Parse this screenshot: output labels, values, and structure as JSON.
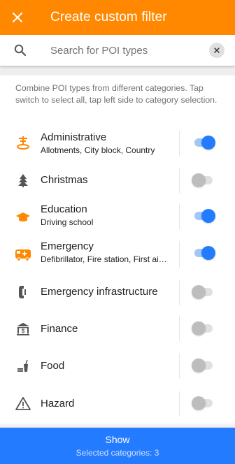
{
  "appbar": {
    "title": "Create custom filter",
    "close_icon": "close-icon"
  },
  "search": {
    "placeholder": "Search for POI types",
    "value": ""
  },
  "description": "Combine POI types from different categories. Tap switch to select all, tap left side to category selection.",
  "colors": {
    "accent": "#ff8800",
    "primary": "#237bff",
    "icon_active": "#ff8800",
    "icon_inactive": "#555555"
  },
  "categories": [
    {
      "name": "Administrative",
      "sub": "Allotments, City block, Country",
      "icon": "administrative-icon",
      "enabled": true
    },
    {
      "name": "Christmas",
      "sub": "",
      "icon": "christmas-tree-icon",
      "enabled": false
    },
    {
      "name": "Education",
      "sub": "Driving school",
      "icon": "education-icon",
      "enabled": true
    },
    {
      "name": "Emergency",
      "sub": "Defibrillator, Fire station, First ai…",
      "icon": "emergency-icon",
      "enabled": true
    },
    {
      "name": "Emergency infrastructure",
      "sub": "",
      "icon": "emergency-phone-icon",
      "enabled": false
    },
    {
      "name": "Finance",
      "sub": "",
      "icon": "finance-icon",
      "enabled": false
    },
    {
      "name": "Food",
      "sub": "",
      "icon": "food-icon",
      "enabled": false
    },
    {
      "name": "Hazard",
      "sub": "",
      "icon": "hazard-icon",
      "enabled": false
    }
  ],
  "bottom": {
    "action": "Show",
    "status": "Selected categories: 3"
  }
}
